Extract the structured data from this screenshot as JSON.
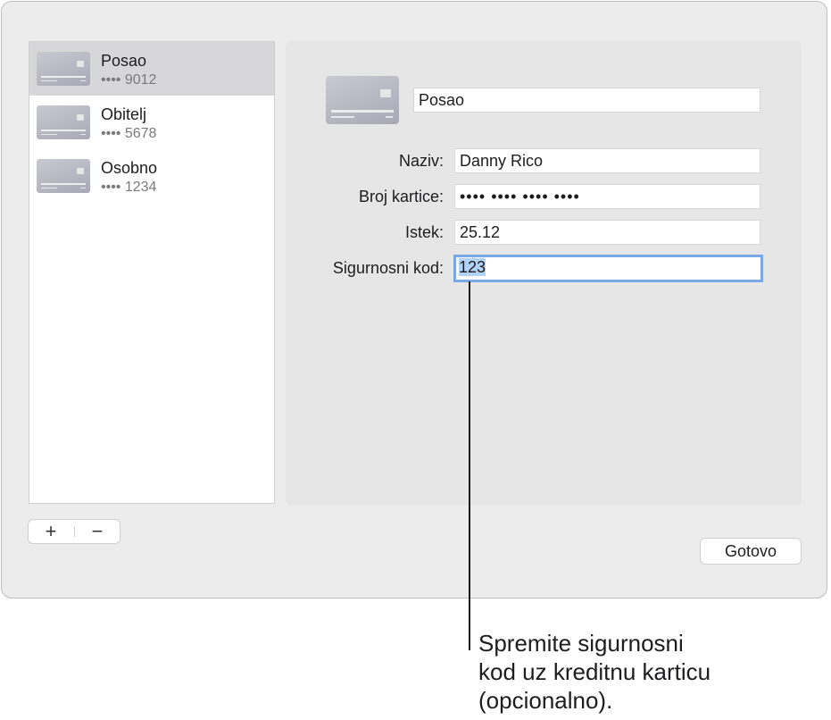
{
  "sidebar": {
    "items": [
      {
        "title": "Posao",
        "masked": "•••• 9012",
        "selected": true
      },
      {
        "title": "Obitelj",
        "masked": "•••• 5678",
        "selected": false
      },
      {
        "title": "Osobno",
        "masked": "•••• 1234",
        "selected": false
      }
    ]
  },
  "detail": {
    "card_title": "Posao",
    "fields": {
      "name": {
        "label": "Naziv:",
        "value": "Danny Rico"
      },
      "number": {
        "label": "Broj kartice:",
        "value": "•••• •••• •••• ••••"
      },
      "expiry": {
        "label": "Istek:",
        "value": "25.12"
      },
      "security": {
        "label": "Sigurnosni kod:",
        "value": "123"
      }
    }
  },
  "buttons": {
    "add": "+",
    "remove": "−",
    "done": "Gotovo"
  },
  "callout": {
    "lines": [
      "Spremite sigurnosni",
      "kod uz kreditnu karticu",
      "(opcionalno)."
    ]
  },
  "colors": {
    "window_bg": "#ececec",
    "selection_bg": "#d7d7d9",
    "focus_ring": "#7aa7e8",
    "text_selection": "#b3d2f7"
  }
}
